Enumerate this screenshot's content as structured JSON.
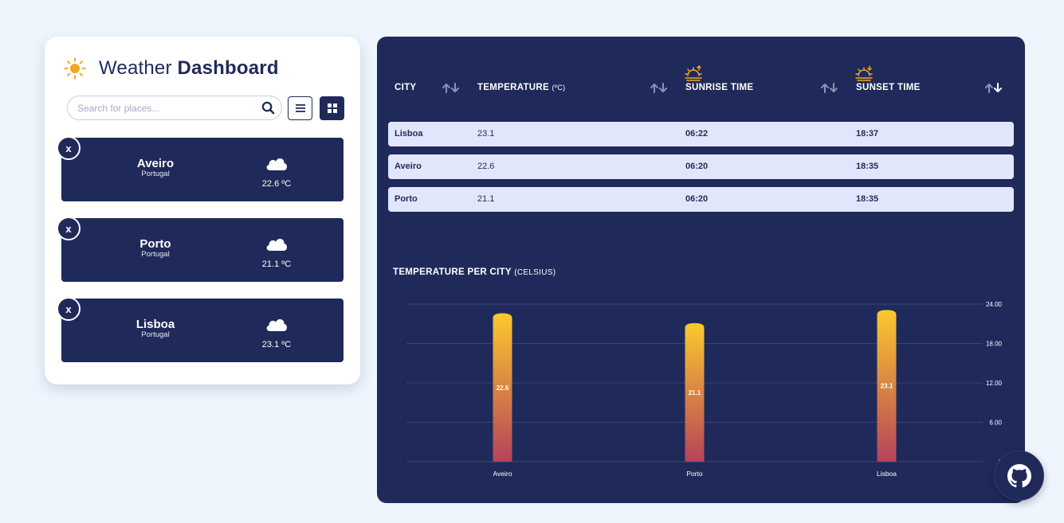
{
  "app": {
    "title_light": "Weather",
    "title_bold": "Dashboard"
  },
  "search": {
    "placeholder": "Search for places...",
    "value": ""
  },
  "cards": [
    {
      "city": "Aveiro",
      "country": "Portugal",
      "temp": "22.6 ºC",
      "remove_label": "x"
    },
    {
      "city": "Porto",
      "country": "Portugal",
      "temp": "21.1 ºC",
      "remove_label": "x"
    },
    {
      "city": "Lisboa",
      "country": "Portugal",
      "temp": "23.1 ºC",
      "remove_label": "x"
    }
  ],
  "table": {
    "headers": {
      "city": "CITY",
      "temperature": "TEMPERATURE",
      "temperature_unit": "(ºC)",
      "sunrise": "SUNRISE TIME",
      "sunset": "SUNSET TIME"
    },
    "rows": [
      {
        "city": "Lisboa",
        "temperature": "23.1",
        "sunrise": "06:22",
        "sunset": "18:37"
      },
      {
        "city": "Aveiro",
        "temperature": "22.6",
        "sunrise": "06:20",
        "sunset": "18:35"
      },
      {
        "city": "Porto",
        "temperature": "21.1",
        "sunrise": "06:20",
        "sunset": "18:35"
      }
    ]
  },
  "chart_data": {
    "type": "bar",
    "title": "TEMPERATURE PER CITY",
    "title_unit": "(CELSIUS)",
    "categories": [
      "Aveiro",
      "Porto",
      "Lisboa"
    ],
    "values": [
      22.6,
      21.1,
      23.1
    ],
    "value_labels": [
      "22.6",
      "21.1",
      "23.1"
    ],
    "ylim": [
      0,
      24
    ],
    "ticks": [
      0,
      6,
      12,
      18,
      24
    ],
    "tick_labels": [
      "0",
      "6.00",
      "12.00",
      "18.00",
      "24.00"
    ],
    "y_axis_side": "right",
    "grid": true,
    "colors": {
      "bar_top": "#fbc92e",
      "bar_bottom": "#b5435a",
      "grid": "#3a4575",
      "text": "#ffffff"
    }
  },
  "colors": {
    "navy": "#1f2a5a",
    "row_bg": "#e1e6fb",
    "page_bg": "#eef5fd",
    "accent": "#f5a623"
  }
}
